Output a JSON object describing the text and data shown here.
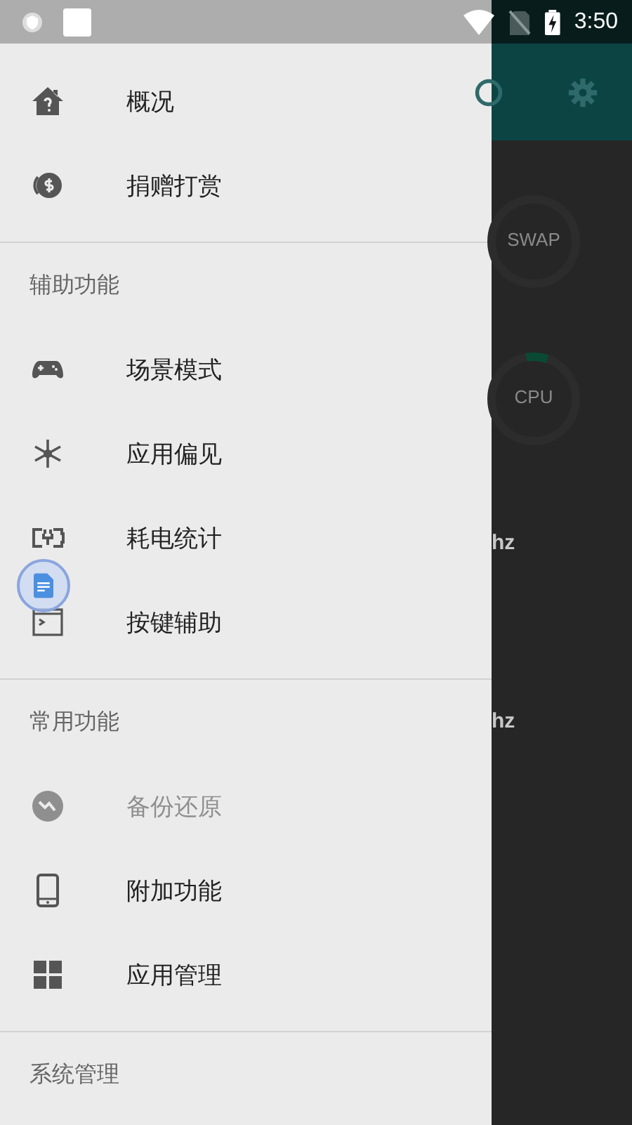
{
  "status_bar": {
    "time": "3:50"
  },
  "drawer": {
    "sections": [
      {
        "items": [
          {
            "label": "概况",
            "disabled": false
          },
          {
            "label": "捐赠打赏",
            "disabled": false
          }
        ]
      },
      {
        "header": "辅助功能",
        "items": [
          {
            "label": "场景模式",
            "disabled": false
          },
          {
            "label": "应用偏见",
            "disabled": false
          },
          {
            "label": "耗电统计",
            "disabled": false
          },
          {
            "label": "按键辅助",
            "disabled": false
          }
        ]
      },
      {
        "header": "常用功能",
        "items": [
          {
            "label": "备份还原",
            "disabled": true
          },
          {
            "label": "附加功能",
            "disabled": false
          },
          {
            "label": "应用管理",
            "disabled": false
          }
        ]
      },
      {
        "header": "系统管理"
      }
    ]
  },
  "background_app": {
    "rings": [
      {
        "label": "SWAP",
        "level": 0
      },
      {
        "label": "CPU",
        "level": 0.08
      }
    ],
    "readings": [
      {
        "value": "hz"
      },
      {
        "value": "hz"
      }
    ]
  }
}
